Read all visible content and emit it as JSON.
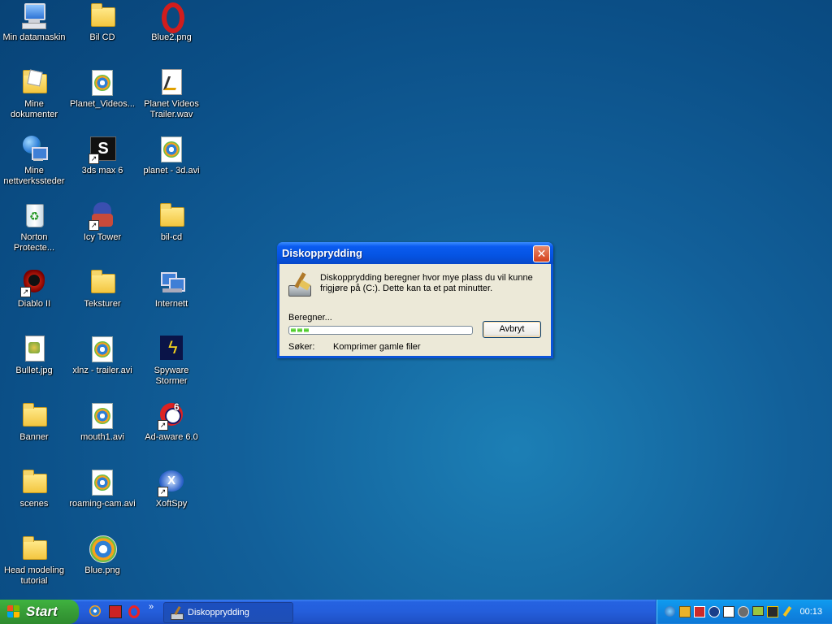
{
  "desktop": {
    "icons": [
      {
        "label": "Min datamaskin",
        "icon": "computer-icon"
      },
      {
        "label": "Bil CD",
        "icon": "folder-icon"
      },
      {
        "label": "Blue2.png",
        "icon": "opera-icon"
      },
      {
        "label": "Mine dokumenter",
        "icon": "documents-folder-icon"
      },
      {
        "label": "Planet_Videos...",
        "icon": "media-file-icon"
      },
      {
        "label": "Planet Videos Trailer.wav",
        "icon": "audio-file-icon"
      },
      {
        "label": "Mine nettverkssteder",
        "icon": "network-places-icon"
      },
      {
        "label": "3ds max 6",
        "icon": "3ds-max-icon"
      },
      {
        "label": "planet - 3d.avi",
        "icon": "media-file-icon"
      },
      {
        "label": "Norton Protecte...",
        "icon": "recycle-bin-icon"
      },
      {
        "label": "Icy Tower",
        "icon": "icy-tower-icon"
      },
      {
        "label": "bil-cd",
        "icon": "folder-icon"
      },
      {
        "label": "Diablo II",
        "icon": "diablo-icon"
      },
      {
        "label": "Teksturer",
        "icon": "folder-icon"
      },
      {
        "label": "Internett",
        "icon": "internet-icon"
      },
      {
        "label": "Bullet.jpg",
        "icon": "image-file-icon"
      },
      {
        "label": "xlnz - trailer.avi",
        "icon": "media-file-icon"
      },
      {
        "label": "Spyware Stormer",
        "icon": "spyware-stormer-icon"
      },
      {
        "label": "Banner",
        "icon": "folder-icon"
      },
      {
        "label": "mouth1.avi",
        "icon": "media-file-icon"
      },
      {
        "label": "Ad-aware 6.0",
        "icon": "ad-aware-icon"
      },
      {
        "label": "scenes",
        "icon": "folder-icon"
      },
      {
        "label": "roaming-cam.avi",
        "icon": "media-file-icon"
      },
      {
        "label": "XoftSpy",
        "icon": "xoftspy-icon"
      },
      {
        "label": "Head modeling tutorial",
        "icon": "folder-icon"
      },
      {
        "label": "Blue.png",
        "icon": "media-player-icon"
      }
    ]
  },
  "dialog": {
    "title": "Diskopprydding",
    "close_label": "✕",
    "message": "Diskopprydding beregner hvor mye plass du vil kunne frigjøre på  (C:). Dette kan ta et pat minutter.",
    "status_label": "Beregner...",
    "progress_segments": 3,
    "cancel_label": "Avbryt",
    "search_label": "Søker:",
    "search_value": "Komprimer gamle filer",
    "icon": "disk-cleanup-icon"
  },
  "taskbar": {
    "start_label": "Start",
    "quick_launch": [
      "media-player-ql-icon",
      "game-ql-icon",
      "opera-ql-icon"
    ],
    "chevron": "»",
    "active_task": "Diskopprydding",
    "clock": "00:13",
    "tray_icons": [
      "network-icon",
      "windows-update-icon",
      "security-icon",
      "antivirus-icon",
      "edit-icon",
      "media-icon",
      "display-icon",
      "graphics-icon",
      "tool-icon"
    ]
  },
  "colors": {
    "desktop_bg": "#0b4f87",
    "titlebar": "#0554e3",
    "start_green": "#379d37",
    "taskbar_blue": "#245edb",
    "tray_blue": "#0f87e2"
  }
}
